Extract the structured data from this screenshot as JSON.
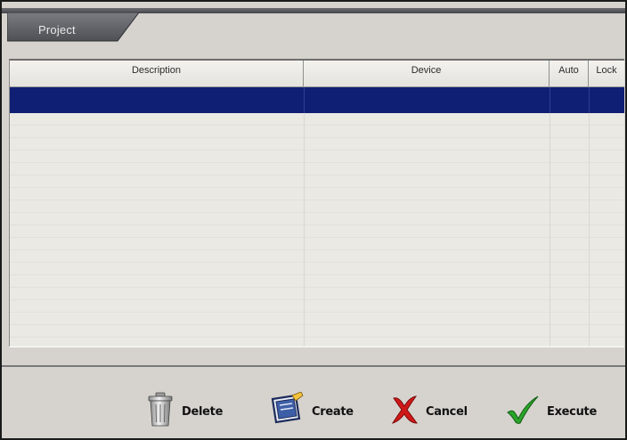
{
  "panel": {
    "tab_title": "Project"
  },
  "table": {
    "columns": [
      {
        "label": "Description"
      },
      {
        "label": "Device"
      },
      {
        "label": "Auto"
      },
      {
        "label": "Lock"
      }
    ],
    "selected_row_index": 0
  },
  "buttons": {
    "delete": {
      "label": "Delete",
      "icon": "trash-can-icon"
    },
    "create": {
      "label": "Create",
      "icon": "create-document-icon"
    },
    "cancel": {
      "label": "Cancel",
      "icon": "red-x-icon"
    },
    "execute": {
      "label": "Execute",
      "icon": "green-checkmark-icon"
    }
  },
  "colors": {
    "selection": "#0f1f73",
    "panel_bg": "#d6d3ce",
    "tab_bg": "#5b5d62",
    "cancel_red": "#d01818",
    "execute_green": "#2aa52a"
  }
}
